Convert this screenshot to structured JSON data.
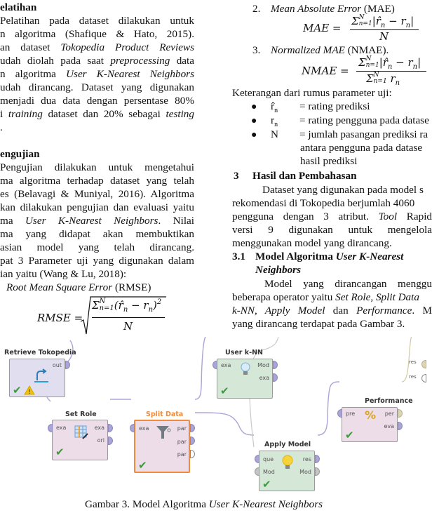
{
  "left_column": {
    "section_pelatihan": {
      "heading": "elatihan",
      "lines": [
        "Pelatihan pada dataset dilakukan untuk",
        "n algoritma (Shafique & Hato, 2015).",
        "an dataset ",
        "udah diolah pada saat ",
        "n algoritma ",
        "udah dirancang. Dataset yang digunakan",
        " menjadi dua data dengan persentase 80%",
        "i ",
        "."
      ],
      "italic": {
        "dataset_name": "Tokopedia Product Reviews",
        "preprocessing": "preprocessing",
        "after_preprocessing": " data",
        "algorithm": "User K-Nearest Neighbors",
        "training": "training",
        "training_after": " dataset dan 20% sebagai ",
        "testing": "testing"
      }
    },
    "section_pengujian": {
      "heading": "engujian",
      "lines": [
        "Pengujian dilakukan untuk mengetahui",
        "ma algoritma terhadap dataset yang telah",
        "es (Belavagi & Muniyal, 2016). Algoritma",
        "kan dilakukan pengujian dan evaluasi yaitu",
        "ma ",
        ". Nilai",
        "ma yang didapat akan membuktikan",
        "asian model yang telah dirancang.",
        "pat 3 Parameter uji yang digunakan dalam",
        "ian yaitu (Wang & Lu, 2018):"
      ],
      "algorithm_italic": "User K-Nearest Neighbors",
      "rmse_item_italic": "Root Mean Square Error",
      "rmse_item_abbrev": " (RMSE)",
      "rmse_formula": {
        "lhs": "RMSE =",
        "numerator": "Σ",
        "sup": "N",
        "sub": "n=1",
        "body": "(r̂",
        "body_sub": "n",
        "minus": " − r",
        "minus_sub": "n",
        "close": ")",
        "power": "2",
        "denominator": "N"
      }
    }
  },
  "right_column": {
    "items": [
      {
        "num": "2.",
        "italic": "Mean Absolute Error",
        "abbrev": " (MAE)"
      },
      {
        "num": "3.",
        "italic": "Normalized MAE",
        "abbrev": "  (NMAE)."
      }
    ],
    "mae_formula": {
      "lhs": "MAE =",
      "num": "Σ",
      "sup": "N",
      "sub": "n=1",
      "body": "|r̂",
      "body_sub": "n",
      "minus": " − r",
      "minus_sub": "n",
      "close": "|",
      "den": "N"
    },
    "nmae_formula": {
      "lhs": "NMAE =",
      "num": "Σ",
      "sup": "N",
      "sub": "n=1",
      "body": "|r̂",
      "body_sub": "n",
      "minus": " − r",
      "minus_sub": "n",
      "close": "|",
      "den": "Σ",
      "den_sup": "N",
      "den_sub": "n=1",
      "den_body": " r",
      "den_body_sub": "n"
    },
    "legend_intro": "Keterangan dari rumus parameter uji:",
    "legend": [
      {
        "symbol": "r̂",
        "sub": "n",
        "desc": "= rating prediksi"
      },
      {
        "symbol": "r",
        "sub": "n",
        "desc": "= rating pengguna pada datase"
      },
      {
        "symbol": "N",
        "sub": "",
        "desc": "= jumlah pasangan prediksi ra"
      }
    ],
    "legend_cont": [
      "antara pengguna pada datase",
      "hasil prediksi"
    ],
    "section_hasil": {
      "num": "3",
      "heading": "Hasil dan Pembahasan",
      "lines": [
        "Dataset yang digunakan pada model s",
        "rekomendasi di Tokopedia berjumlah 4060",
        "pengguna dengan 3 atribut. ",
        " Rapid",
        "versi 9 digunakan untuk mengelola",
        "menggunakan model yang dirancang."
      ],
      "tool_italic": "Tool"
    },
    "section_31": {
      "num": "3.1",
      "heading_plain": "Model Algoritma ",
      "heading_italic": "User K-Nearest",
      "heading_italic2": "Neighbors",
      "lines": [
        "Model yang dirancangan menggu",
        "beberapa operator yaitu ",
        "dan ",
        "yang dirancang terdapat pada Gambar 3."
      ],
      "ops_italic": "Set Role, Split Data",
      "ops_italic2": "k-NN, Apply Model",
      "ops_italic3": "Performance",
      "ops_after": ". M"
    }
  },
  "diagram": {
    "operators": [
      {
        "id": "retrieve",
        "title": "Retrieve Tokopedia",
        "ports_out": [
          "out"
        ],
        "status": "ok-warning"
      },
      {
        "id": "set_role",
        "title": "Set Role",
        "ports_in": [
          "exa"
        ],
        "ports_out": [
          "exa",
          "ori"
        ],
        "status": "ok"
      },
      {
        "id": "split_data",
        "title": "Split Data",
        "ports_in": [
          "exa"
        ],
        "ports_out": [
          "par",
          "par",
          "par"
        ],
        "status": "ok",
        "selected": true
      },
      {
        "id": "user_knn",
        "title": "User k-NN",
        "ports_in": [
          "exa"
        ],
        "ports_out": [
          "Mod",
          "exa"
        ],
        "status": "ok"
      },
      {
        "id": "apply_model",
        "title": "Apply Model",
        "ports_in": [
          "que",
          "Mod"
        ],
        "ports_out": [
          "res",
          "Mod"
        ],
        "status": "ok"
      },
      {
        "id": "performance",
        "title": "Performance",
        "ports_in": [
          "pre"
        ],
        "ports_out": [
          "per",
          "eva"
        ],
        "status": "ok"
      }
    ],
    "result_ports": [
      "res",
      "res"
    ],
    "colors": {
      "selected_title": "#f08a3c",
      "connection": "#a9a5d6",
      "ok": "#3c9a3c",
      "warning": "#f2c200"
    }
  },
  "caption": {
    "plain": "Gambar 3. Model Algoritma ",
    "italic": "User K-Nearest Neighbors"
  }
}
